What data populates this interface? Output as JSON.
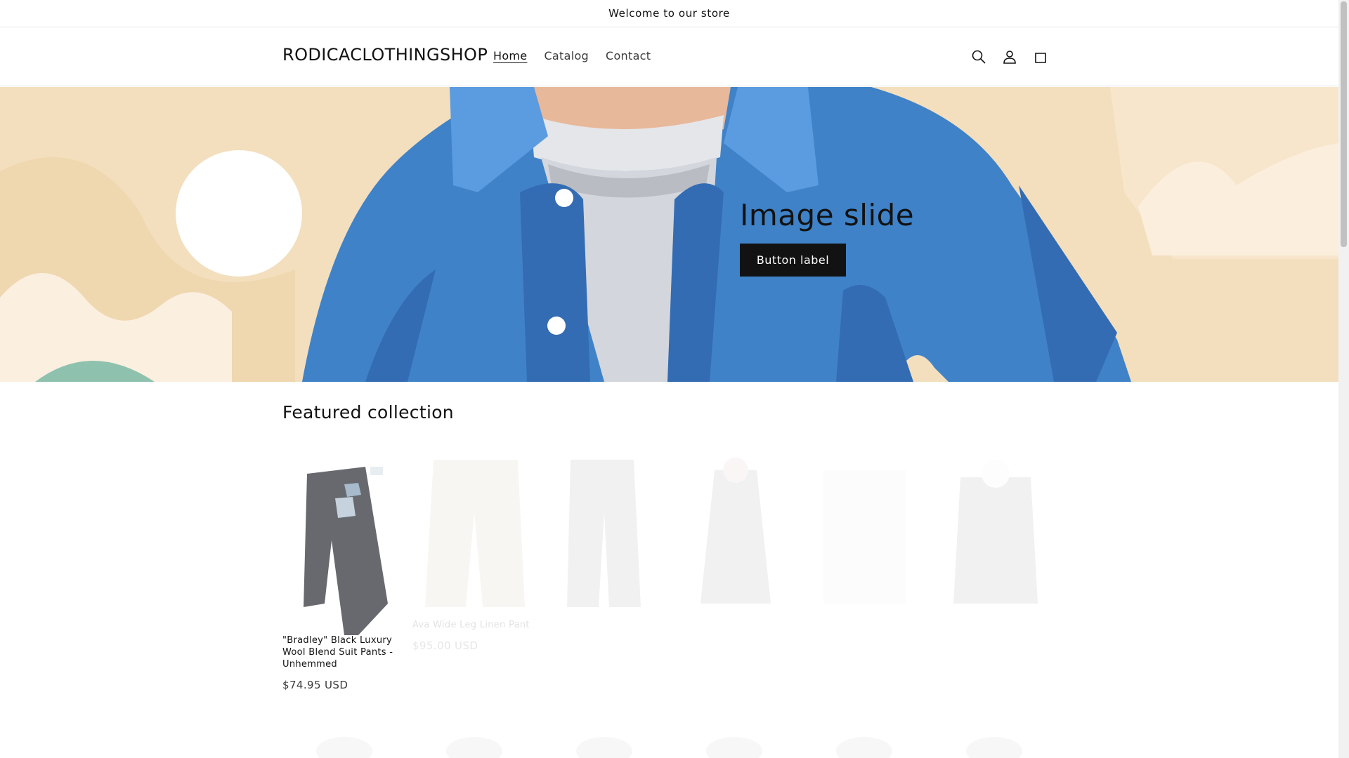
{
  "announcement": {
    "text": "Welcome to our store"
  },
  "header": {
    "logo": "RODICACLOTHINGSHOP",
    "nav": [
      {
        "label": "Home",
        "active": true
      },
      {
        "label": "Catalog",
        "active": false
      },
      {
        "label": "Contact",
        "active": false
      }
    ],
    "icons": [
      "search-icon",
      "account-icon",
      "cart-icon"
    ]
  },
  "hero": {
    "title": "Image slide",
    "button_label": "Button label"
  },
  "featured": {
    "title": "Featured collection",
    "products": [
      {
        "title": "\"Bradley\" Black Luxury Wool Blend Suit Pants - Unhemmed",
        "price": "$74.95 USD"
      },
      {
        "title": "Ava Wide Leg Linen Pant",
        "price": "$95.00 USD"
      }
    ]
  },
  "colors": {
    "accent": "#121212",
    "hero_bg": "#f3dfbd",
    "jacket": "#3f82c8"
  }
}
